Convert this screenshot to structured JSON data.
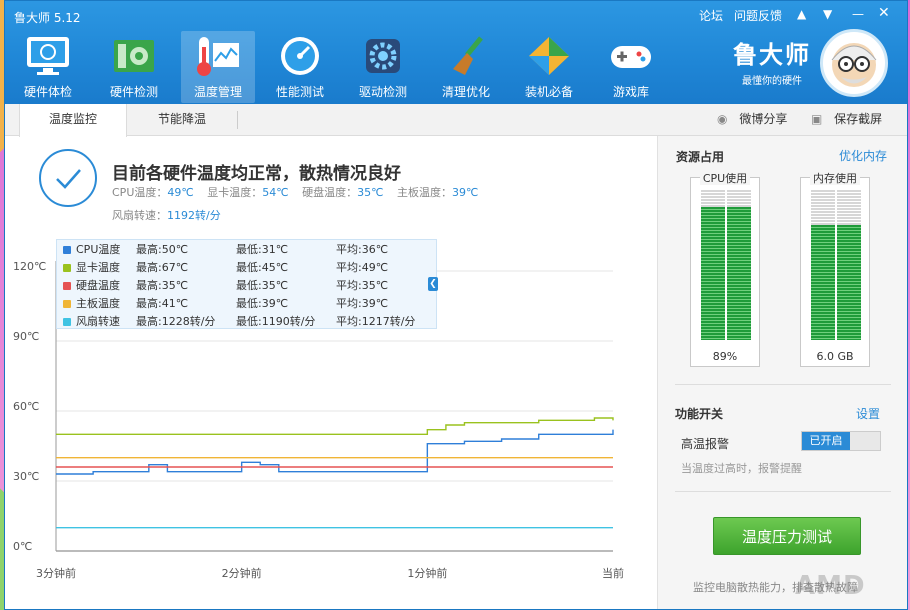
{
  "app": {
    "title": "鲁大师 5.12"
  },
  "titlebar": {
    "forum": "论坛",
    "feedback": "问题反馈"
  },
  "toolbar": [
    {
      "label": "硬件体检",
      "icon": "monitor-icon"
    },
    {
      "label": "硬件检测",
      "icon": "circuit-board-icon"
    },
    {
      "label": "温度管理",
      "icon": "thermometer-icon",
      "active": true
    },
    {
      "label": "性能测试",
      "icon": "speedometer-icon"
    },
    {
      "label": "驱动检测",
      "icon": "gear-icon"
    },
    {
      "label": "清理优化",
      "icon": "broom-icon"
    },
    {
      "label": "装机必备",
      "icon": "package-icon"
    },
    {
      "label": "游戏库",
      "icon": "gamepad-icon"
    }
  ],
  "brand": {
    "name": "鲁大师",
    "slogan": "最懂你的硬件"
  },
  "tabs": [
    {
      "label": "温度监控"
    },
    {
      "label": "节能降温"
    }
  ],
  "share": {
    "weibo": "微博分享",
    "screenshot": "保存截屏"
  },
  "status": {
    "headline": "目前各硬件温度均正常，散热情况良好",
    "cpu_label": "CPU温度：",
    "cpu_value": "49℃",
    "gpu_label": "显卡温度：",
    "gpu_value": "54℃",
    "disk_label": "硬盘温度：",
    "disk_value": "35℃",
    "board_label": "主板温度：",
    "board_value": "39℃",
    "fan_label": "风扇转速：",
    "fan_value": "1192转/分"
  },
  "legend": [
    {
      "name": "CPU温度",
      "max": "最高:50℃",
      "min": "最低:31℃",
      "avg": "平均:36℃",
      "color": "#2f7fd9"
    },
    {
      "name": "显卡温度",
      "max": "最高:67℃",
      "min": "最低:45℃",
      "avg": "平均:49℃",
      "color": "#9ac21e"
    },
    {
      "name": "硬盘温度",
      "max": "最高:35℃",
      "min": "最低:35℃",
      "avg": "平均:35℃",
      "color": "#e55353"
    },
    {
      "name": "主板温度",
      "max": "最高:41℃",
      "min": "最低:39℃",
      "avg": "平均:39℃",
      "color": "#f0b536"
    },
    {
      "name": "风扇转速",
      "max": "最高:1228转/分",
      "min": "最低:1190转/分",
      "avg": "平均:1217转/分",
      "color": "#3fc3e3"
    }
  ],
  "chart_data": {
    "type": "line",
    "y_ticks": [
      "120℃",
      "90℃",
      "60℃",
      "30℃",
      "0℃"
    ],
    "ylim": [
      0,
      120
    ],
    "x_ticks": [
      "3分钟前",
      "2分钟前",
      "1分钟前",
      "当前"
    ],
    "x": [
      0,
      6,
      12,
      18,
      24,
      30,
      36,
      42,
      48,
      54,
      60,
      66,
      72,
      78,
      84,
      90,
      96,
      102,
      108,
      114,
      120,
      126,
      132,
      138,
      144,
      150,
      156,
      162,
      168,
      174,
      180
    ],
    "series": [
      {
        "color": "#2f7fd9",
        "values": [
          33,
          33,
          34,
          34,
          34,
          37,
          34,
          34,
          34,
          34,
          38,
          37,
          34,
          34,
          34,
          34,
          34,
          34,
          34,
          34,
          46,
          46,
          47,
          47,
          48,
          48,
          50,
          50,
          50,
          50,
          52
        ]
      },
      {
        "color": "#9ac21e",
        "values": [
          50,
          50,
          50,
          50,
          50,
          50,
          50,
          50,
          50,
          50,
          50,
          50,
          50,
          50,
          50,
          50,
          50,
          50,
          50,
          50,
          52,
          54,
          55,
          55,
          55,
          55,
          56,
          56,
          56,
          57,
          56
        ]
      },
      {
        "color": "#f0b536",
        "values": [
          40,
          40,
          40,
          40,
          40,
          40,
          40,
          40,
          40,
          40,
          40,
          40,
          40,
          40,
          40,
          40,
          40,
          40,
          40,
          40,
          40,
          40,
          40,
          40,
          40,
          40,
          40,
          40,
          40,
          40,
          40
        ]
      },
      {
        "color": "#e55353",
        "values": [
          36,
          36,
          36,
          36,
          36,
          36,
          36,
          36,
          36,
          36,
          36,
          36,
          36,
          36,
          36,
          36,
          36,
          36,
          36,
          36,
          36,
          36,
          36,
          36,
          36,
          36,
          36,
          36,
          36,
          36,
          36
        ]
      },
      {
        "color": "#3fc3e3",
        "values": [
          10,
          10,
          10,
          10,
          10,
          10,
          10,
          10,
          10,
          10,
          10,
          10,
          10,
          10,
          10,
          10,
          10,
          10,
          10,
          10,
          10,
          10,
          10,
          10,
          10,
          10,
          10,
          10,
          10,
          10,
          10
        ]
      }
    ]
  },
  "resources": {
    "title": "资源占用",
    "optimize": "优化内存",
    "cpu_label": "CPU使用",
    "cpu_value": "89%",
    "cpu_fraction": 0.89,
    "mem_label": "内存使用",
    "mem_value": "6.0 GB",
    "mem_fraction": 0.77
  },
  "features": {
    "title": "功能开关",
    "settings": "设置",
    "alarm_label": "高温报警",
    "alarm_state": "已开启",
    "alarm_desc": "当温度过高时，报警提醒"
  },
  "stress_button": "温度压力测试",
  "footer_note": "监控电脑散热能力，排查散热故障",
  "watermark": "AMD"
}
